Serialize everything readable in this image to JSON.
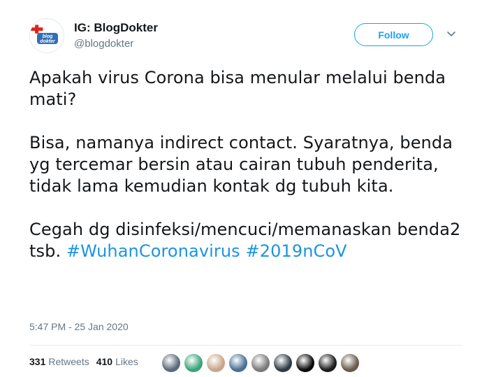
{
  "author": {
    "display_name": "IG: BlogDokter",
    "handle": "@blogdokter",
    "avatar_icon": "blogdokter-logo-icon"
  },
  "header": {
    "follow_label": "Follow",
    "more_icon": "chevron-down-icon"
  },
  "tweet": {
    "paragraph_1": "Apakah virus Corona bisa menular melalui benda mati?",
    "paragraph_2": "Bisa, namanya indirect contact. Syaratnya, benda yg tercemar bersin atau cairan tubuh penderita, tidak lama kemudian kontak dg tubuh kita.",
    "paragraph_3_text": "Cegah dg disinfeksi/mencuci/memanaskan benda2 tsb.",
    "hashtags": [
      "#WuhanCoronavirus",
      "#2019nCoV"
    ]
  },
  "timestamp": "5:47 PM - 25 Jan 2020",
  "stats": {
    "retweets_count": "331",
    "retweets_label": "Retweets",
    "likes_count": "410",
    "likes_label": "Likes"
  },
  "colors": {
    "accent": "#1da1f2",
    "hashtag": "#1b95e0",
    "secondary_text": "#657786",
    "primary_text": "#14171a"
  },
  "likers": [
    {
      "color": "#5a6a7a"
    },
    {
      "color": "#3aa37a"
    },
    {
      "color": "#c8a58a"
    },
    {
      "color": "#4a6f95"
    },
    {
      "color": "#7a7a7a"
    },
    {
      "color": "#2f3b45"
    },
    {
      "color": "#0a0a0a"
    },
    {
      "color": "#1c1c1c"
    },
    {
      "color": "#6a5a4a"
    }
  ]
}
